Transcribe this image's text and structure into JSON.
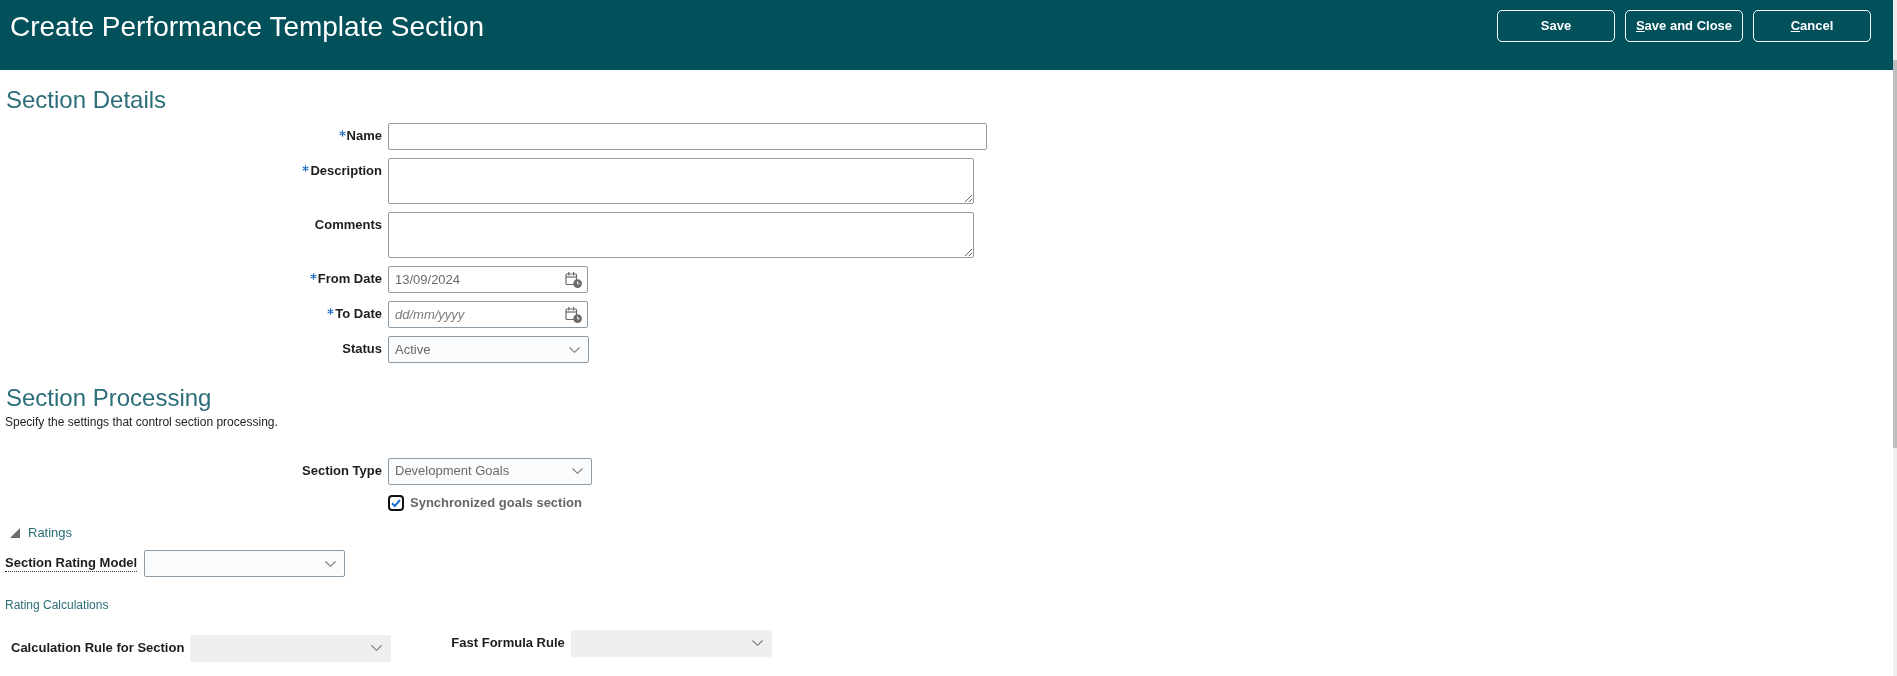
{
  "header": {
    "title": "Create Performance Template Section",
    "buttons": [
      {
        "label": "Save",
        "access_key_underlined": false
      },
      {
        "label": "Save and Close",
        "access_key_underlined": true
      },
      {
        "label": "Cancel",
        "access_key_underlined": true
      }
    ]
  },
  "section_details": {
    "heading": "Section Details",
    "fields": [
      {
        "label": "Name",
        "required": true,
        "kind": "text"
      },
      {
        "label": "Description",
        "required": true,
        "kind": "textarea"
      },
      {
        "label": "Comments",
        "required": false,
        "kind": "textarea"
      },
      {
        "label": "From Date",
        "required": true,
        "kind": "date",
        "value": "13/09/2024"
      },
      {
        "label": "To Date",
        "required": true,
        "kind": "date",
        "placeholder": "dd/mm/yyyy"
      },
      {
        "label": "Status",
        "required": false,
        "kind": "select",
        "value": "Active"
      }
    ]
  },
  "section_processing": {
    "heading": "Section Processing",
    "description": "Specify the settings that control section processing.",
    "fields": [
      {
        "label": "Section Type",
        "required": false,
        "kind": "select",
        "value": "Development Goals"
      }
    ],
    "checkbox": {
      "label": "Synchronized goals section",
      "checked": true
    }
  },
  "ratings": {
    "title": "Ratings",
    "expanded": true,
    "rating_model": {
      "label": "Section Rating Model",
      "disabled": false
    },
    "calculations_heading": "Rating Calculations",
    "calculation_fields": [
      {
        "label": "Calculation Rule for Section",
        "disabled": true
      },
      {
        "label": "Fast Formula Rule",
        "disabled": true
      }
    ]
  }
}
